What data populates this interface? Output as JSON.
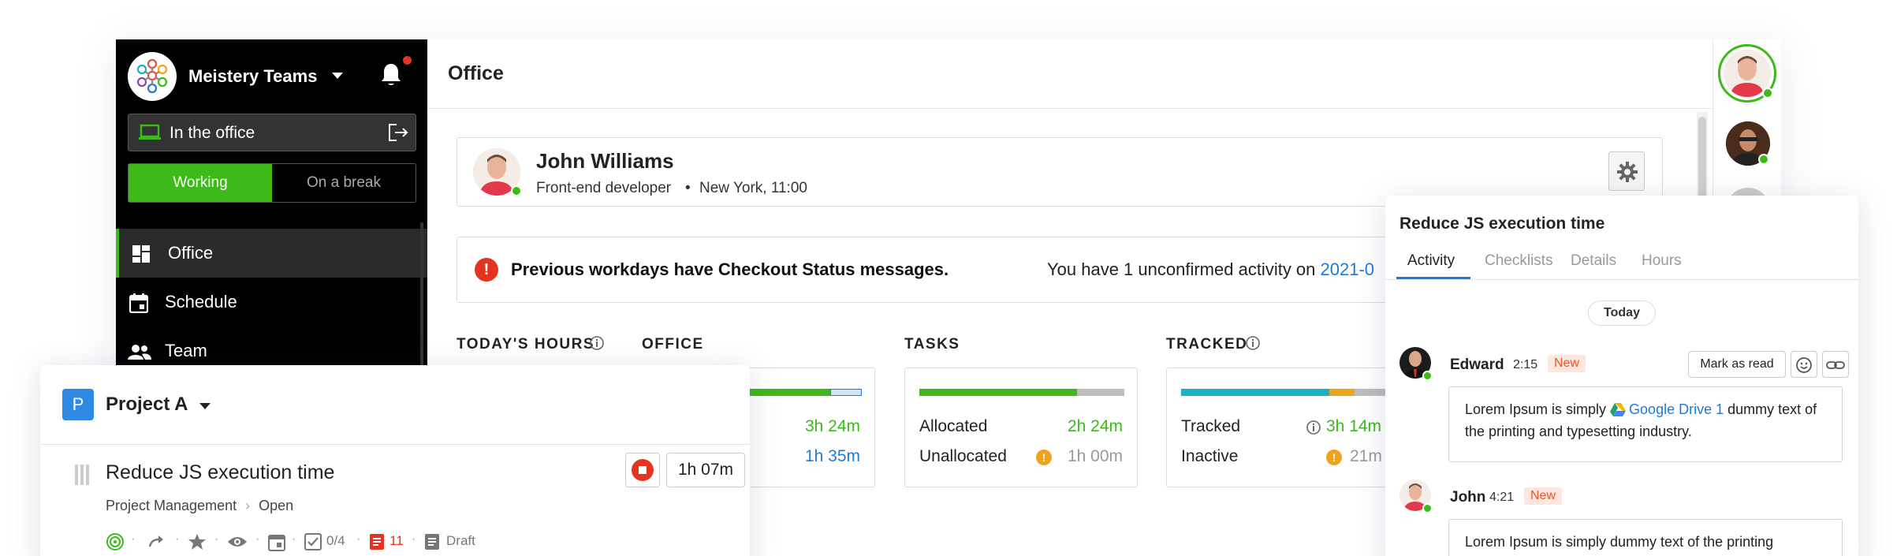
{
  "sidebar": {
    "team_name": "Meistery Teams",
    "status_label": "In the office",
    "toggle_working": "Working",
    "toggle_break": "On a break",
    "nav": [
      {
        "label": "Office"
      },
      {
        "label": "Schedule"
      },
      {
        "label": "Team"
      }
    ]
  },
  "header": {
    "title": "Office"
  },
  "user": {
    "name": "John Williams",
    "role": "Front-end developer",
    "location": "New York, 11:00",
    "separator": "•"
  },
  "notice": {
    "text": "Previous workdays have Checkout Status messages.",
    "right_text": "You have 1 unconfirmed activity on ",
    "right_link": "2021-0"
  },
  "stats": {
    "todays_hours_label": "TODAY'S HOURS",
    "office": {
      "label": "OFFICE",
      "value1": "3h 24m",
      "value2": "1h 35m"
    },
    "tasks": {
      "label": "TASKS",
      "allocated_label": "Allocated",
      "allocated_value": "2h 24m",
      "unallocated_label": "Unallocated",
      "unallocated_value": "1h 00m"
    },
    "tracked": {
      "label": "TRACKED",
      "tracked_label": "Tracked",
      "tracked_value": "3h 14m",
      "inactive_label": "Inactive",
      "inactive_value": "21m"
    }
  },
  "project": {
    "badge": "P",
    "name": "Project A",
    "task_title": "Reduce JS execution time",
    "breadcrumb_a": "Project Management",
    "breadcrumb_sep": "›",
    "breadcrumb_b": "Open",
    "timer": "1h 07m",
    "checklist_count": "0/4",
    "doc_count": "11",
    "draft_label": "Draft"
  },
  "activity": {
    "title": "Reduce JS execution time",
    "tabs": [
      "Activity",
      "Checklists",
      "Details",
      "Hours"
    ],
    "day_label": "Today",
    "mark_as_read": "Mark as read",
    "messages": [
      {
        "author": "Edward",
        "time": "2:15",
        "badge": "New",
        "text_before": "Lorem Ipsum is simply ",
        "link": "Google Drive 1",
        "text_after": " dummy text of the printing and typesetting industry."
      },
      {
        "author": "John",
        "time": "4:21",
        "badge": "New",
        "text": "Lorem Ipsum is simply dummy text of the printing"
      }
    ]
  },
  "colors": {
    "accent_green": "#3cba19",
    "link_blue": "#1e7ad8",
    "alert_red": "#e53322",
    "warning_orange": "#f0a21c",
    "teal": "#19b3c4"
  }
}
